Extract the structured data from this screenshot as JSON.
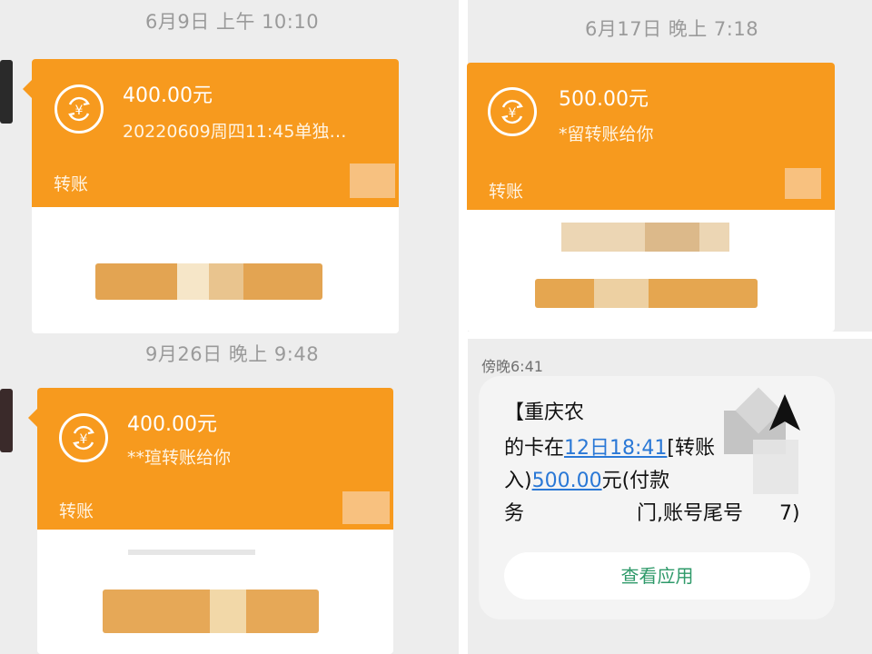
{
  "panels": [
    {
      "timestamp": "6月9日 上午 10:10",
      "amount": "400.00元",
      "note": "20220609周四11:45单独…",
      "type_label": "转账"
    },
    {
      "timestamp": "9月26日 晚上 9:48",
      "amount": "400.00元",
      "note": "**瑄转账给你",
      "type_label": "转账"
    },
    {
      "timestamp": "6月17日 晚上 7:18",
      "amount": "500.00元",
      "note": "*留转账给你",
      "type_label": "转账"
    }
  ],
  "sms": {
    "time": "傍晚6:41",
    "line1": "【重庆农",
    "line2_prefix": "的卡在",
    "line2_link": "12日18:41",
    "line2_suffix": "[转账",
    "line3_prefix": "入)",
    "line3_link": "500.00",
    "line3_suffix": "元(付款",
    "line4_a": "务",
    "line4_b": "门,账号尾号",
    "line4_c": "7)",
    "button": "查看应用"
  },
  "icons": {
    "transfer": "yuan-transfer-icon"
  },
  "colors": {
    "accent": "#f79a1e",
    "link": "#2a78d6",
    "button_text": "#2f9a6a"
  }
}
